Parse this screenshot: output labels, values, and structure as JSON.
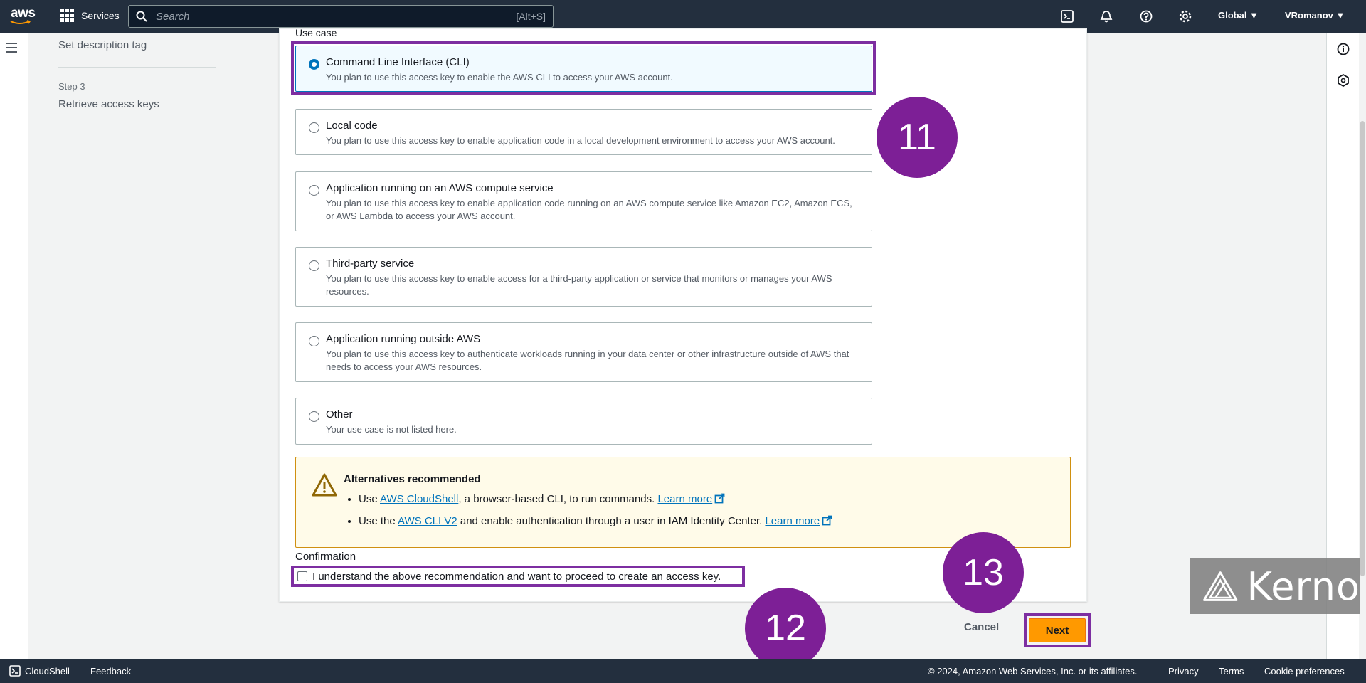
{
  "nav": {
    "logo_text": "aws",
    "services_label": "Services",
    "search_placeholder": "Search",
    "search_shortcut": "[Alt+S]",
    "region": "Global ▼",
    "user": "VRomanov ▼"
  },
  "steps": {
    "prev_title": "Set description tag",
    "step3_label": "Step 3",
    "step3_title": "Retrieve access keys"
  },
  "use_case": {
    "section_label": "Use case",
    "options": [
      {
        "title": "Command Line Interface (CLI)",
        "desc": "You plan to use this access key to enable the AWS CLI to access your AWS account.",
        "selected": true
      },
      {
        "title": "Local code",
        "desc": "You plan to use this access key to enable application code in a local development environment to access your AWS account.",
        "selected": false
      },
      {
        "title": "Application running on an AWS compute service",
        "desc": "You plan to use this access key to enable application code running on an AWS compute service like Amazon EC2, Amazon ECS, or AWS Lambda to access your AWS account.",
        "selected": false
      },
      {
        "title": "Third-party service",
        "desc": "You plan to use this access key to enable access for a third-party application or service that monitors or manages your AWS resources.",
        "selected": false
      },
      {
        "title": "Application running outside AWS",
        "desc": "You plan to use this access key to authenticate workloads running in your data center or other infrastructure outside of AWS that needs to access your AWS resources.",
        "selected": false
      },
      {
        "title": "Other",
        "desc": "Your use case is not listed here.",
        "selected": false
      }
    ]
  },
  "alert": {
    "title": "Alternatives recommended",
    "item1": {
      "pre": "Use ",
      "link": "AWS CloudShell",
      "mid": ", a browser-based CLI, to run commands. ",
      "learn": "Learn more"
    },
    "item2": {
      "pre": "Use the ",
      "link": "AWS CLI V2",
      "mid": " and enable authentication through a user in IAM Identity Center. ",
      "learn": "Learn more"
    }
  },
  "confirmation": {
    "label": "Confirmation",
    "checkbox_text": "I understand the above recommendation and want to proceed to create an access key.",
    "checked": false
  },
  "actions": {
    "cancel": "Cancel",
    "next": "Next"
  },
  "annotations": {
    "n11": "11",
    "n12": "12",
    "n13": "13"
  },
  "watermark": "Kerno",
  "footer": {
    "cloudshell": "CloudShell",
    "feedback": "Feedback",
    "copyright": "© 2024, Amazon Web Services, Inc. or its affiliates.",
    "privacy": "Privacy",
    "terms": "Terms",
    "cookies": "Cookie preferences"
  },
  "colors": {
    "nav_bg": "#232f3e",
    "accent": "#0073bb",
    "primary_button": "#ff9900",
    "annotation": "#7d1f96"
  }
}
